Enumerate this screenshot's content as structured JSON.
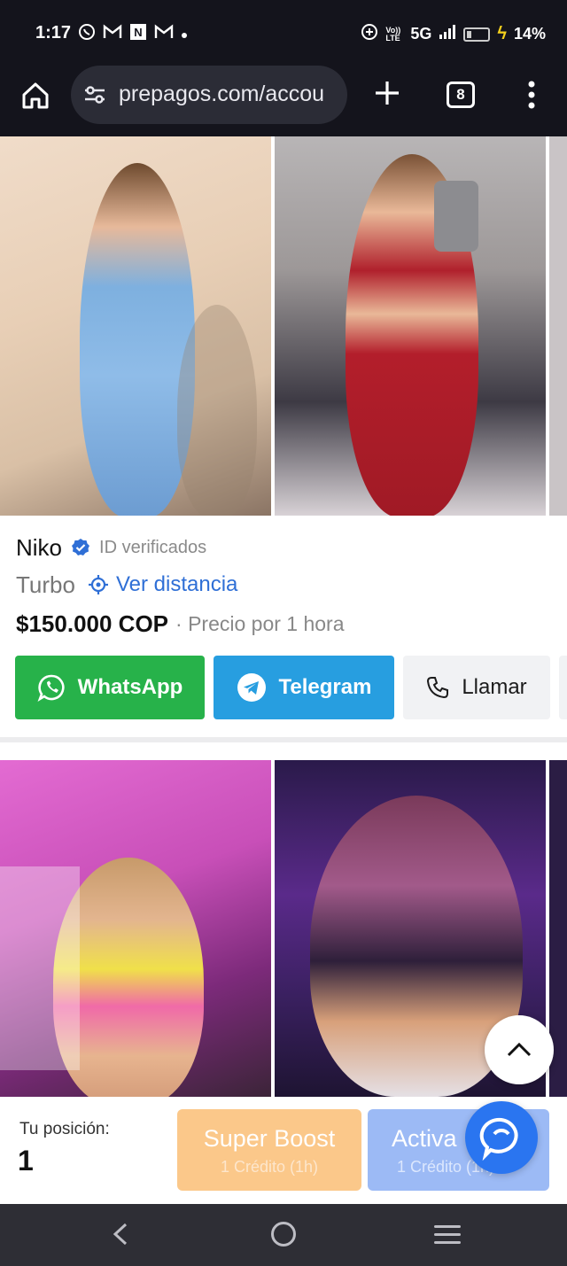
{
  "status_bar": {
    "time": "1:17",
    "network": "5G",
    "volte": "Vo)) LTE",
    "battery": "14%"
  },
  "browser": {
    "url": "prepagos.com/accou",
    "tab_count": "8"
  },
  "listing": {
    "name": "Niko",
    "verified_label": "ID verificados",
    "tier": "Turbo",
    "distance_label": "Ver distancia",
    "price": "$150.000 COP",
    "price_note": "· Precio por 1 hora"
  },
  "contacts": {
    "whatsapp": "WhatsApp",
    "telegram": "Telegram",
    "call": "Llamar"
  },
  "bottom_panel": {
    "position_label": "Tu posición:",
    "position_value": "1",
    "super_boost_label": "Super Boost",
    "super_boost_cost": "1 Crédito (1h)",
    "activate_label": "Activa",
    "activate_cost": "1 Crédito (1h)"
  },
  "colors": {
    "whatsapp": "#27b24a",
    "telegram": "#279ee0",
    "link": "#2f6fd6",
    "boost": "#fbc88a",
    "activate": "#9cbaf5",
    "chat": "#2a75f0"
  }
}
